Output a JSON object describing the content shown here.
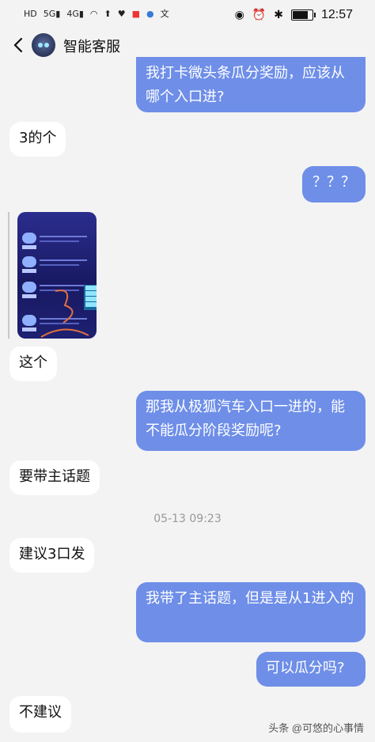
{
  "status_bar": {
    "left_icons": [
      "HD",
      "5G",
      "signal",
      "4G",
      "signal",
      "wifi",
      "upload",
      "heart",
      "red-app",
      "blue-app",
      "translate"
    ],
    "time": "12:57",
    "battery_level": 0.85
  },
  "header": {
    "title": "智能客服"
  },
  "messages": [
    {
      "sender": "me",
      "text": "我打卡微头条瓜分奖励，应该从哪个入口进?"
    },
    {
      "sender": "bot",
      "text": "3的个"
    },
    {
      "sender": "me",
      "text": "？？？"
    },
    {
      "sender": "bot",
      "type": "image"
    },
    {
      "sender": "bot",
      "text": "这个"
    },
    {
      "sender": "me",
      "text": "那我从极狐汽车入口一进的，能不能瓜分阶段奖励呢?"
    },
    {
      "sender": "bot",
      "text": "要带主话题"
    },
    {
      "sender": "bot",
      "text": "建议3口发"
    },
    {
      "sender": "me",
      "text": "我带了主话题，但是是从1进入的"
    },
    {
      "sender": "me",
      "text": "可以瓜分吗?"
    },
    {
      "sender": "bot",
      "text": "不建议"
    }
  ],
  "timestamp": "05-13 09:23",
  "watermark": "头条 @可悠的心事情",
  "colors": {
    "me_bubble": "#6e8ee8",
    "bot_bubble": "#ffffff",
    "background": "#f3f3f3"
  }
}
